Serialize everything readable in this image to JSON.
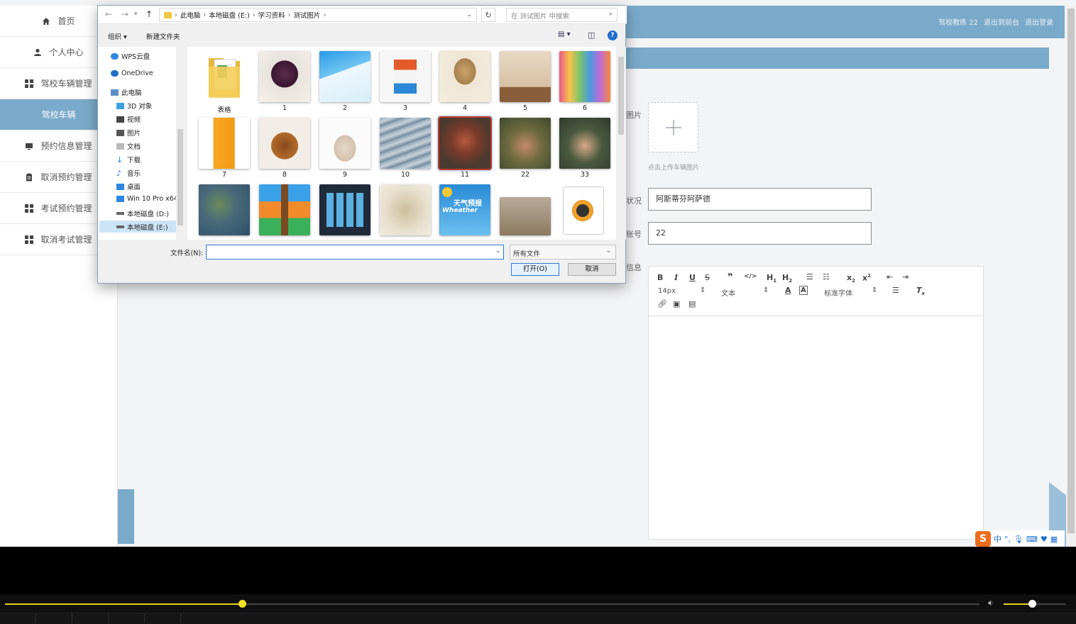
{
  "sidebar": {
    "items": [
      {
        "label": "首页",
        "icon": "home-icon",
        "active": false
      },
      {
        "label": "个人中心",
        "icon": "user-icon",
        "active": false
      },
      {
        "label": "驾校车辆管理",
        "icon": "grid-icon",
        "active": false
      },
      {
        "label": "驾校车辆",
        "icon": "",
        "active": true
      },
      {
        "label": "预约信息管理",
        "icon": "monitor-icon",
        "active": false
      },
      {
        "label": "取消预约管理",
        "icon": "clipboard-icon",
        "active": false
      },
      {
        "label": "考试预约管理",
        "icon": "grid-icon",
        "active": false
      },
      {
        "label": "取消考试管理",
        "icon": "grid-icon",
        "active": false
      }
    ]
  },
  "header": {
    "user": "驾校教练 22",
    "back_front": "退出到前台",
    "logout": "退出登录"
  },
  "form": {
    "image_label": "图片",
    "upload_hint": "点击上传车辆图片",
    "status_label": "状况",
    "status_value": "阿斯蒂芬阿萨德",
    "account_label": "账号",
    "account_value": "22",
    "info_label": "信息",
    "editor": {
      "font_size": "14px",
      "text_type": "文本",
      "font_family": "标准字体"
    }
  },
  "dialog": {
    "breadcrumb": [
      "此电脑",
      "本地磁盘 (E:)",
      "学习资料",
      "测试图片"
    ],
    "search_placeholder": "在 测试图片 中搜索",
    "organize": "组织 ▾",
    "new_folder": "新建文件夹",
    "nav": [
      {
        "label": "WPS云盘",
        "color": "#2f86e0"
      },
      {
        "label": "OneDrive",
        "color": "#1f6fc9"
      },
      {
        "label": "此电脑",
        "color": "#5b8fc7"
      },
      {
        "label": "3D 对象",
        "color": "#3fa0e0"
      },
      {
        "label": "视频",
        "color": "#444"
      },
      {
        "label": "图片",
        "color": "#555"
      },
      {
        "label": "文档",
        "color": "#888"
      },
      {
        "label": "下载",
        "color": "#2a78d6"
      },
      {
        "label": "音乐",
        "color": "#2a78d6"
      },
      {
        "label": "桌面",
        "color": "#2f86e0"
      },
      {
        "label": "Win 10 Pro x64",
        "color": "#2f86e0"
      },
      {
        "label": "本地磁盘 (D:)",
        "color": "#666"
      },
      {
        "label": "本地磁盘 (E:)",
        "color": "#666"
      }
    ],
    "files_row1": [
      "表格",
      "1",
      "2",
      "3",
      "4",
      "5",
      "6"
    ],
    "files_row2": [
      "7",
      "8",
      "9",
      "10",
      "11",
      "22",
      "33"
    ],
    "thumb_text": {
      "weather": "天气预报",
      "weather_en": "Wheather"
    },
    "filename_label": "文件名(N):",
    "filename_value": "",
    "filetype": "所有文件",
    "open_button": "打开(O)",
    "cancel_button": "取消"
  },
  "ime": {
    "lang": "中",
    "punct": "°,",
    "logo": "S"
  },
  "player": {
    "progress": 0.243,
    "volume": 0.45
  }
}
